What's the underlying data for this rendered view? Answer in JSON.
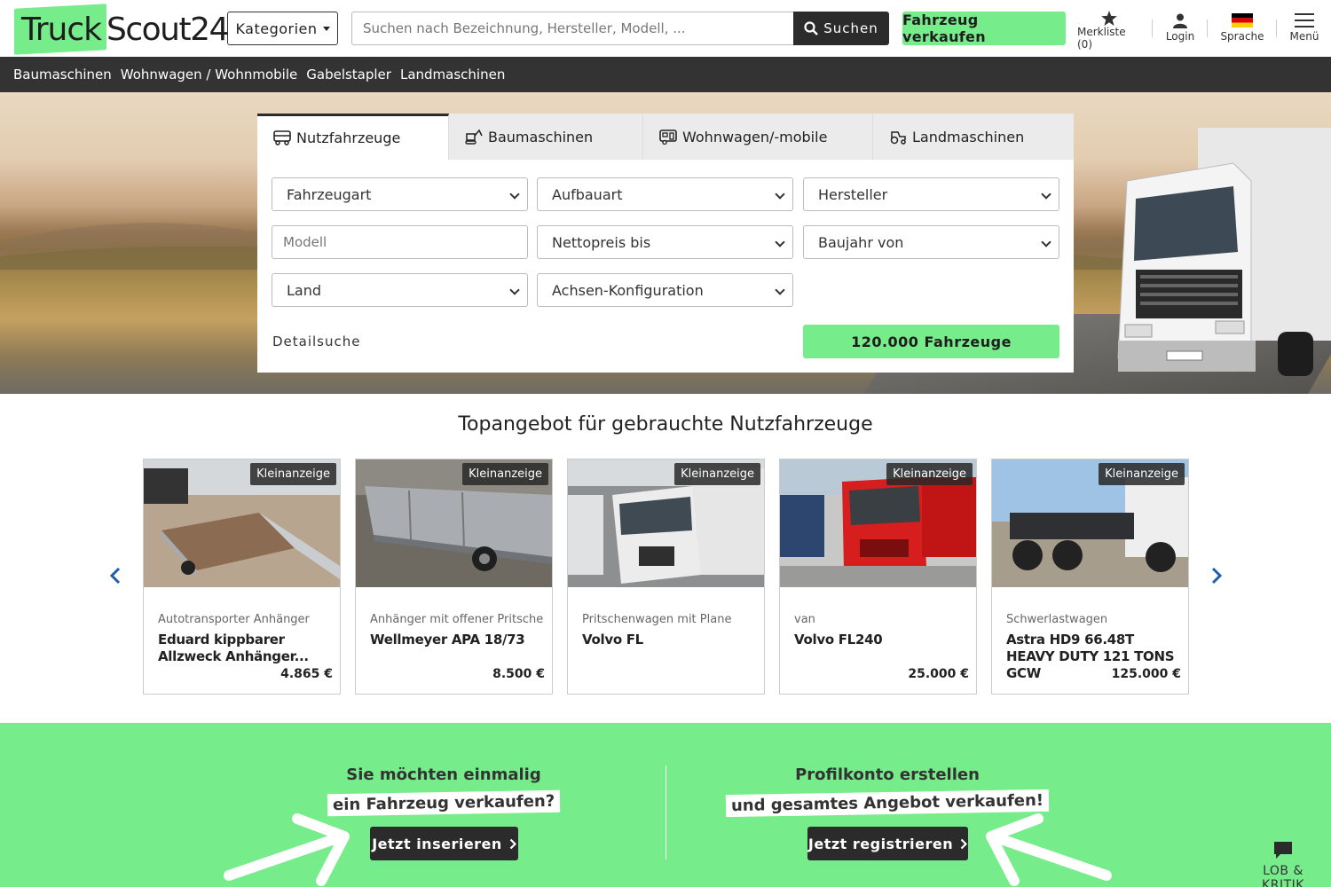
{
  "brand": {
    "logo_part1": "Truck",
    "logo_part2": "Scout24",
    "accent": "#76ec8a",
    "dark": "#2b2b2b"
  },
  "header": {
    "categories_label": "Kategorien",
    "search_placeholder": "Suchen nach Bezeichnung, Hersteller, Modell, ...",
    "search_button": "Suchen",
    "sell_button": "Fahrzeug verkaufen",
    "watchlist": "Merkliste (0)",
    "login": "Login",
    "language": "Sprache",
    "menu": "Menü"
  },
  "subnav": [
    "Baumaschinen",
    "Wohnwagen / Wohnmobile",
    "Gabelstapler",
    "Landmaschinen"
  ],
  "search_panel": {
    "tabs": [
      {
        "label": "Nutzfahrzeuge",
        "icon": "truck-icon",
        "active": true
      },
      {
        "label": "Baumaschinen",
        "icon": "excavator-icon",
        "active": false
      },
      {
        "label": "Wohnwagen/-mobile",
        "icon": "camper-icon",
        "active": false
      },
      {
        "label": "Landmaschinen",
        "icon": "tractor-icon",
        "active": false
      }
    ],
    "fields": {
      "fahrzeugart": "Fahrzeugart",
      "aufbauart": "Aufbauart",
      "hersteller": "Hersteller",
      "modell_placeholder": "Modell",
      "nettopreis": "Nettopreis bis",
      "baujahr": "Baujahr von",
      "land": "Land",
      "achsen": "Achsen-Konfiguration"
    },
    "detail_link": "Detailsuche",
    "result_button": "120.000 Fahrzeuge"
  },
  "top_offers": {
    "title": "Topangebot für gebrauchte Nutzfahrzeuge",
    "cards": [
      {
        "badge": "Kleinanzeige",
        "category": "Autotransporter Anhänger",
        "name": "Eduard kippbarer Allzweck Anhänger...",
        "price": "4.865 €"
      },
      {
        "badge": "Kleinanzeige",
        "category": "Anhänger mit offener Pritsche",
        "name": "Wellmeyer APA 18/73",
        "price": "8.500 €"
      },
      {
        "badge": "Kleinanzeige",
        "category": "Pritschenwagen mit Plane",
        "name": "Volvo FL",
        "price": ""
      },
      {
        "badge": "Kleinanzeige",
        "category": "van",
        "name": "Volvo FL240",
        "price": "25.000 €"
      },
      {
        "badge": "Kleinanzeige",
        "category": "Schwerlastwagen",
        "name": "Astra HD9 66.48T HEAVY DUTY 121 TONS GCW",
        "price": "125.000 €"
      }
    ]
  },
  "cta": {
    "left_line1": "Sie möchten einmalig",
    "left_line2": "ein Fahrzeug verkaufen?",
    "left_button": "Jetzt inserieren",
    "right_line1": "Profilkonto erstellen",
    "right_line2": "und gesamtes Angebot verkaufen!",
    "right_button": "Jetzt registrieren"
  },
  "feedback_label": "LOB & KRITIK"
}
